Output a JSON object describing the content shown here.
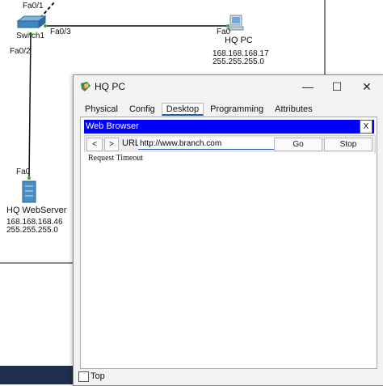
{
  "topology": {
    "switch_port_top": "Fa0/1",
    "switch_name": "Switch1",
    "switch_port_right": "Fa0/3",
    "switch_port_down": "Fa0/2",
    "pc_port": "Fa0",
    "pc_name": "HQ PC",
    "pc_ip": "168.168.168.17",
    "pc_mask": "255.255.255.0",
    "server_port": "Fa0",
    "server_name": "HQ WebServer",
    "server_ip": "168.168.168.46",
    "server_mask": "255.255.255.0"
  },
  "window": {
    "title": "HQ PC",
    "minimize_glyph": "—",
    "maximize_glyph": "☐",
    "close_glyph": "✕",
    "tabs": [
      {
        "label": "Physical"
      },
      {
        "label": "Config"
      },
      {
        "label": "Desktop"
      },
      {
        "label": "Programming"
      },
      {
        "label": "Attributes"
      }
    ],
    "active_tab": "Desktop"
  },
  "browser": {
    "title": "Web Browser",
    "close_label": "X",
    "back_label": "<",
    "forward_label": ">",
    "url_label": "URL",
    "url_value": "http://www.branch.com",
    "go_label": "Go",
    "stop_label": "Stop",
    "page_text": "Request Timeout"
  },
  "footer": {
    "top_label": "Top",
    "top_checked": false
  },
  "colors": {
    "browser_bar": "#0000ff",
    "tab_accent": "#1f5bb5",
    "link_line": "#111111",
    "port_dot": "#2bb52b"
  }
}
